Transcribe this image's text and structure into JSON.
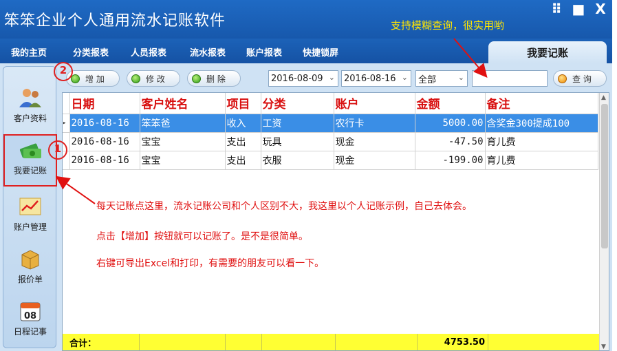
{
  "app": {
    "title": "笨笨企业个人通用流水记账软件",
    "top_hint": "支持模糊查询，很实用哟",
    "window_controls": [
      {
        "icon": "grid-icon",
        "glyph": "⠿"
      },
      {
        "icon": "maximize-icon",
        "glyph": "■"
      },
      {
        "icon": "close-icon",
        "glyph": "X"
      }
    ]
  },
  "menu": {
    "items": [
      "我的主页",
      "分类报表",
      "人员报表",
      "流水报表",
      "账户报表",
      "快捷锁屏"
    ],
    "active_tab": "我要记账"
  },
  "sidebar": {
    "items": [
      {
        "label": "客户资料",
        "icon": "users-icon"
      },
      {
        "label": "我要记账",
        "icon": "money-icon"
      },
      {
        "label": "账户管理",
        "icon": "chart-icon"
      },
      {
        "label": "报价单",
        "icon": "package-icon"
      },
      {
        "label": "日程记事",
        "icon": "calendar-icon",
        "badge": "08"
      }
    ]
  },
  "toolbar": {
    "add_label": "增 加",
    "edit_label": "修 改",
    "delete_label": "删 除",
    "date_from": "2016-08-09",
    "date_to": "2016-08-16",
    "category_filter": "全部",
    "search_placeholder": "",
    "search_label": "查 询"
  },
  "table": {
    "columns": [
      "日期",
      "客户姓名",
      "项目",
      "分类",
      "账户",
      "金额",
      "备注"
    ],
    "rows": [
      {
        "date": "2016-08-16",
        "customer": "笨笨爸",
        "item": "收入",
        "category": "工资",
        "account": "农行卡",
        "amount": "5000.00",
        "note": "含奖金300提成100",
        "selected": true
      },
      {
        "date": "2016-08-16",
        "customer": "宝宝",
        "item": "支出",
        "category": "玩具",
        "account": "现金",
        "amount": "-47.50",
        "note": "育儿费",
        "selected": false
      },
      {
        "date": "2016-08-16",
        "customer": "宝宝",
        "item": "支出",
        "category": "衣服",
        "account": "现金",
        "amount": "-199.00",
        "note": "育儿费",
        "selected": false
      }
    ],
    "total_label": "合计：",
    "total_amount": "4753.50"
  },
  "annotations": {
    "step1": "1",
    "step2": "2",
    "line1": "每天记账点这里，流水记账公司和个人区别不大，我这里以个人记账示例，自己去体会。",
    "line2": "点击【增加】按钮就可以记账了。是不是很简单。",
    "line3": "右键可导出Excel和打印，有需要的朋友可以看一下。"
  },
  "colors": {
    "title_bg": "#1a5fb4",
    "header_text": "#d81010",
    "selected_row": "#3a8ee6",
    "total_row": "#ffff33",
    "annotation": "#e01010",
    "hint": "#ffe600"
  }
}
